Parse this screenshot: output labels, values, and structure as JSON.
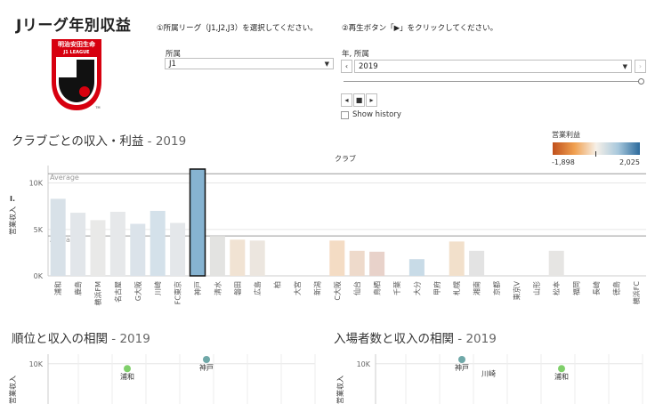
{
  "header": {
    "title": "Jリーグ年別収益",
    "instruction_1": "①所属リーグ（J1,J2,J3）を選択してください。",
    "instruction_2": "②再生ボタン「▶」をクリックしてください。"
  },
  "logo": {
    "text_top": "明治安田生命",
    "text_bottom": "J1 LEAGUE",
    "tm": "TM",
    "colors": {
      "red": "#d7000f",
      "black": "#111111"
    }
  },
  "filters": {
    "league_label": "所属",
    "league_value": "J1",
    "year_label": "年, 所属",
    "year_value": "2019",
    "show_history_label": "Show history"
  },
  "club_chart": {
    "section_title": "クラブごとの収入・利益",
    "year": "- 2019",
    "x_title": "クラブ",
    "y_title": "営業収入",
    "legend": {
      "title": "営業利益",
      "min": "-1,898",
      "max": "2,025"
    }
  },
  "rank_chart": {
    "section_title": "順位と収入の相関",
    "year": "- 2019"
  },
  "att_chart": {
    "section_title": "入場者数と収入の相関",
    "year": "- 2019"
  },
  "chart_data": [
    {
      "type": "bar",
      "x_title": "クラブ",
      "y_title": "営業収入",
      "ylim": [
        0,
        11500
      ],
      "yticks": [
        0,
        5000,
        10000
      ],
      "ytick_labels": [
        "0K",
        "5K",
        "10K"
      ],
      "average_lines": [
        {
          "label": "Average",
          "value": 11000
        },
        {
          "label": "Average",
          "value": 4300
        }
      ],
      "categories": [
        "浦和",
        "鹿島",
        "横浜FM",
        "名古屋",
        "G大阪",
        "川崎",
        "FC東京",
        "神戸",
        "清水",
        "磐田",
        "広島",
        "柏",
        "大宮",
        "新潟",
        "C大阪",
        "仙台",
        "鳥栖",
        "千葉",
        "大分",
        "甲府",
        "札幌",
        "湘南",
        "京都",
        "東京V",
        "山形",
        "松本",
        "福岡",
        "長崎",
        "徳島",
        "横浜FC"
      ],
      "values": [
        8300,
        6800,
        6000,
        6900,
        5600,
        7000,
        5700,
        11500,
        4300,
        3900,
        3800,
        null,
        null,
        null,
        3800,
        2700,
        2600,
        null,
        1800,
        null,
        3700,
        2700,
        null,
        null,
        null,
        2700,
        null,
        null,
        null,
        null
      ],
      "colors": [
        "#d8e1e8",
        "#e2e6ea",
        "#e9e9e8",
        "#e6e8ea",
        "#dbe3ea",
        "#d4e1ea",
        "#e4e7ea",
        "#86b3d1",
        "#e3e3e1",
        "#f1e3d3",
        "#ece6df",
        null,
        null,
        null,
        "#f4dcc4",
        "#eedacb",
        "#e8d2ca",
        null,
        "#c8dbe7",
        null,
        "#f2e0cb",
        "#e3e3e3",
        null,
        null,
        null,
        "#e6e5e3",
        null,
        null,
        null,
        null
      ],
      "highlight": "神戸"
    },
    {
      "type": "scatter",
      "y_title": "営業収入",
      "yticks": [
        "10K"
      ],
      "points": [
        {
          "label": "神戸",
          "y": 11500,
          "color": "#6fa8a8"
        },
        {
          "label": "浦和",
          "y": 8300,
          "color": "#7fcf6a"
        }
      ]
    },
    {
      "type": "scatter",
      "y_title": "営業収入",
      "yticks": [
        "10K"
      ],
      "points": [
        {
          "label": "神戸",
          "y": 11500,
          "color": "#6fa8a8"
        },
        {
          "label": "川崎",
          "y": 7000,
          "color": null
        },
        {
          "label": "浦和",
          "y": 8300,
          "color": "#7fcf6a"
        }
      ]
    }
  ]
}
